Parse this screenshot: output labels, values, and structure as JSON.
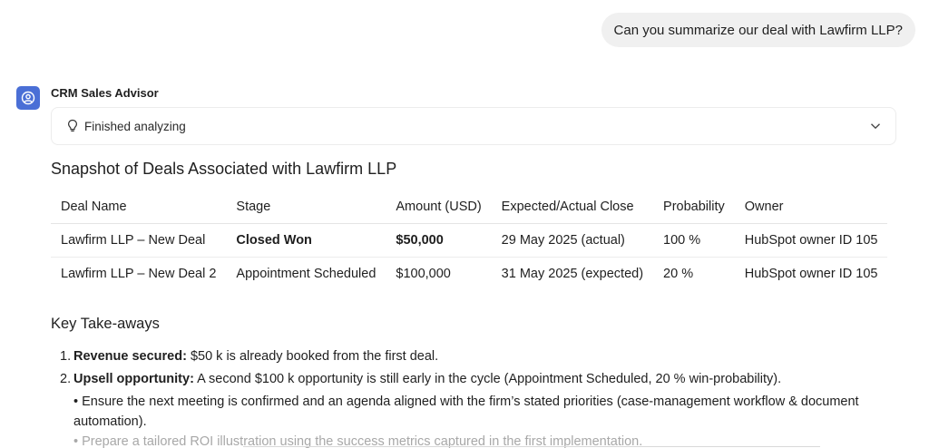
{
  "user_message": "Can you summarize our deal with Lawfirm LLP?",
  "assistant": {
    "name": "CRM Sales Advisor",
    "avatar_icon": "user-circle-icon",
    "avatar_color": "#4a6fd6",
    "status": "Finished analyzing",
    "status_icon": "lightbulb-icon",
    "expand_icon": "chevron-down-icon"
  },
  "snapshot": {
    "title": "Snapshot of Deals Associated with Lawfirm LLP",
    "columns": [
      "Deal Name",
      "Stage",
      "Amount (USD)",
      "Expected/Actual Close",
      "Probability",
      "Owner"
    ],
    "rows": [
      [
        "Lawfirm LLP – New Deal",
        "Closed Won",
        "$50,000",
        "29 May 2025 (actual)",
        "100 %",
        "HubSpot owner ID 105"
      ],
      [
        "Lawfirm LLP – New Deal 2",
        "Appointment Scheduled",
        "$100,000",
        "31 May 2025 (expected)",
        "20 %",
        "HubSpot owner ID 105"
      ]
    ]
  },
  "takeaways": {
    "title": "Key Take-aways",
    "items": [
      {
        "num": "1.",
        "label": "Revenue secured:",
        "text": " $50 k is already booked from the first deal."
      },
      {
        "num": "2.",
        "label": "Upsell opportunity:",
        "text": " A second $100 k opportunity is still early in the cycle (Appointment Scheduled, 20 % win-probability)."
      }
    ],
    "bullets": [
      "• Ensure the next meeting is confirmed and an agenda aligned with the firm’s stated priorities (case-management workflow & document automation).",
      "• Prepare a tailored ROI illustration using the success metrics captured in the first implementation."
    ]
  }
}
